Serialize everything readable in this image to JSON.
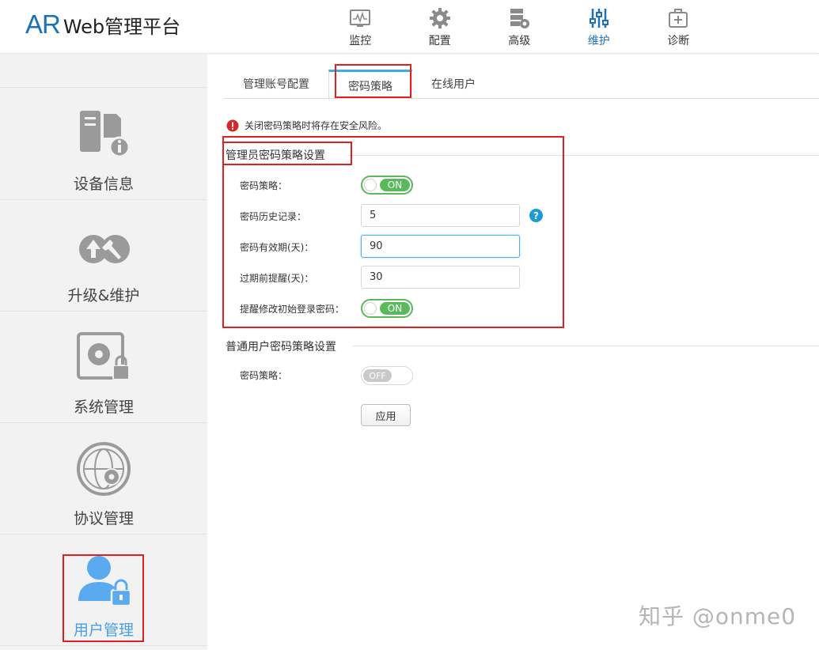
{
  "header": {
    "logo_ar": "AR",
    "logo_rest": "Web管理平台",
    "nav": [
      {
        "label": "监控",
        "icon": "monitor-icon",
        "active": false
      },
      {
        "label": "配置",
        "icon": "gear-icon",
        "active": false
      },
      {
        "label": "高级",
        "icon": "server-gear-icon",
        "active": false
      },
      {
        "label": "维护",
        "icon": "sliders-icon",
        "active": true
      },
      {
        "label": "诊断",
        "icon": "medical-kit-icon",
        "active": false
      }
    ]
  },
  "sidebar": {
    "items": [
      {
        "label": "设备信息",
        "icon": "device-info-icon",
        "active": false
      },
      {
        "label": "升级&维护",
        "icon": "upgrade-wrench-icon",
        "active": false
      },
      {
        "label": "系统管理",
        "icon": "system-lock-icon",
        "active": false
      },
      {
        "label": "协议管理",
        "icon": "globe-gear-icon",
        "active": false
      },
      {
        "label": "用户管理",
        "icon": "user-lock-icon",
        "active": true
      }
    ]
  },
  "tabs": [
    {
      "label": "管理账号配置",
      "active": false
    },
    {
      "label": "密码策略",
      "active": true
    },
    {
      "label": "在线用户",
      "active": false
    }
  ],
  "warning": "关闭密码策略时将存在安全风险。",
  "admin_section": {
    "title": "管理员密码策略设置",
    "policy_label": "密码策略：",
    "policy_state": "ON",
    "history_label": "密码历史记录：",
    "history_value": "5",
    "help": "?",
    "validity_label": "密码有效期(天)：",
    "validity_value": "90",
    "remind_label": "过期前提醒(天)：",
    "remind_value": "30",
    "initial_label": "提醒修改初始登录密码：",
    "initial_state": "ON"
  },
  "user_section": {
    "title": "普通用户密码策略设置",
    "policy_label": "密码策略：",
    "policy_state": "OFF"
  },
  "apply_label": "应用",
  "watermark": "知乎 @onme0",
  "colors": {
    "brand": "#1a73b8",
    "active_tab": "#39b0e0",
    "toggle_on": "#5cb85c",
    "highlight": "#e02020",
    "warning": "#d9262c"
  }
}
